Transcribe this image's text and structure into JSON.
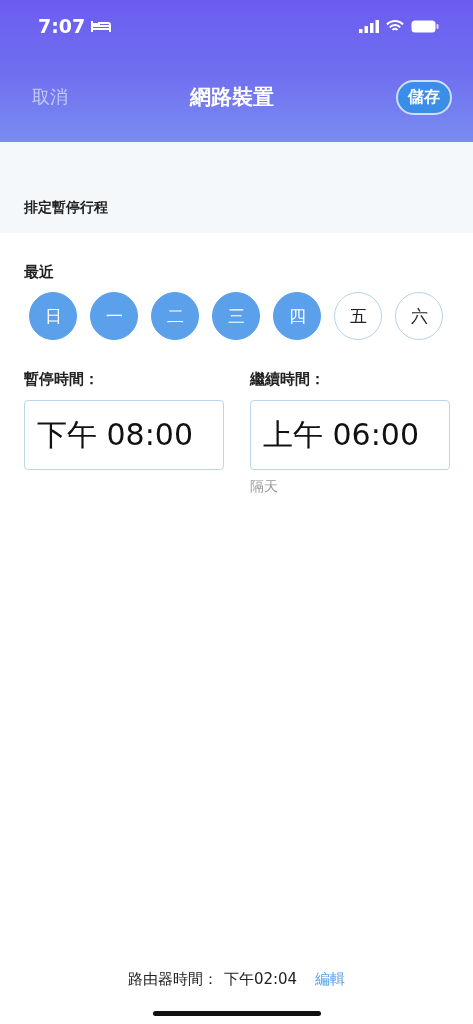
{
  "status_bar": {
    "time": "7:07"
  },
  "nav": {
    "cancel": "取消",
    "title": "網路裝置",
    "save": "儲存"
  },
  "section": {
    "title": "排定暫停行程"
  },
  "recent": {
    "label": "最近",
    "days": [
      {
        "label": "日",
        "selected": true
      },
      {
        "label": "一",
        "selected": true
      },
      {
        "label": "二",
        "selected": true
      },
      {
        "label": "三",
        "selected": true
      },
      {
        "label": "四",
        "selected": true
      },
      {
        "label": "五",
        "selected": false
      },
      {
        "label": "六",
        "selected": false
      }
    ]
  },
  "times": [
    {
      "label": "暫停時間：",
      "value": "下午 08:00"
    },
    {
      "label": "繼續時間：",
      "value": "上午 06:00",
      "note": "隔天"
    }
  ],
  "footer": {
    "label": "路由器時間：",
    "value": "下午02:04",
    "edit": "編輯"
  }
}
